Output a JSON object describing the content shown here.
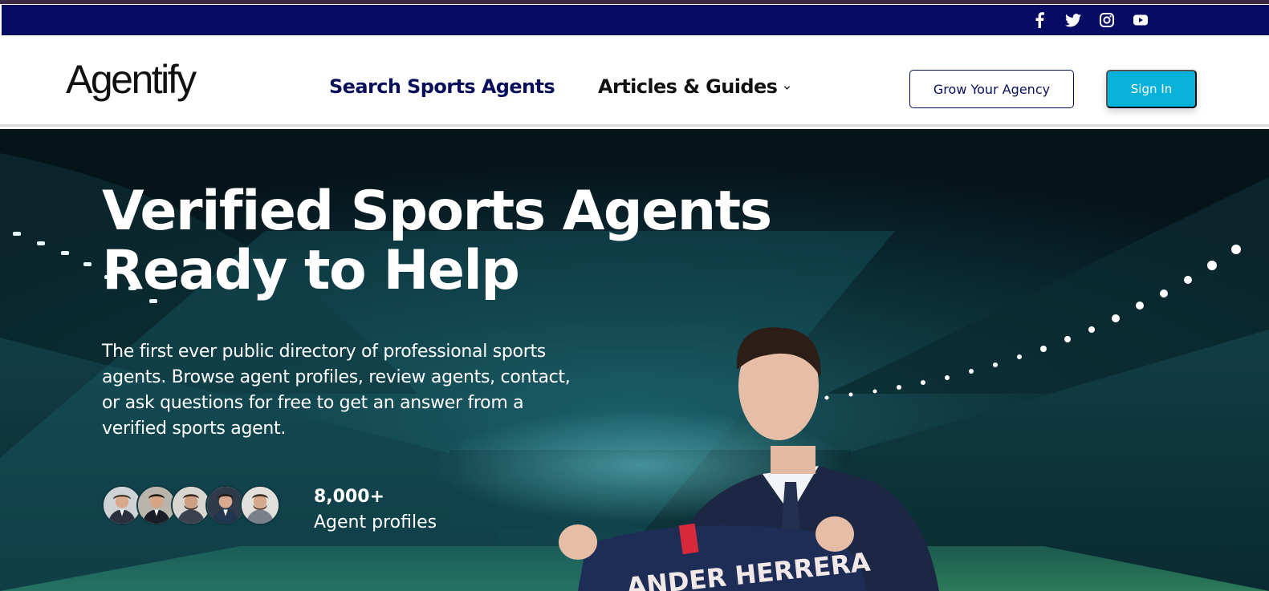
{
  "social": {
    "icons": [
      "facebook-icon",
      "twitter-icon",
      "instagram-icon",
      "youtube-icon"
    ]
  },
  "header": {
    "logo": "Agentify",
    "nav": {
      "search_label": "Search Sports Agents",
      "articles_label": "Articles & Guides"
    },
    "grow_button": "Grow Your Agency",
    "signin_button": "Sign In"
  },
  "hero": {
    "title_line1": "Verified Sports Agents",
    "title_line2": "Ready to Help",
    "description": "The first ever public directory of professional sports agents. Browse agent profiles, review agents, contact, or ask questions for free to get an answer from a verified sports agent.",
    "stat_number": "8,000+",
    "stat_label": "Agent profiles",
    "jersey_text": "ANDER HERRERA"
  },
  "colors": {
    "social_bar": "#060b63",
    "nav_primary": "#0a0f5c",
    "signin_bg": "#06b2d9",
    "hero_dark": "#08222a",
    "hero_teal": "#1d5b63"
  }
}
